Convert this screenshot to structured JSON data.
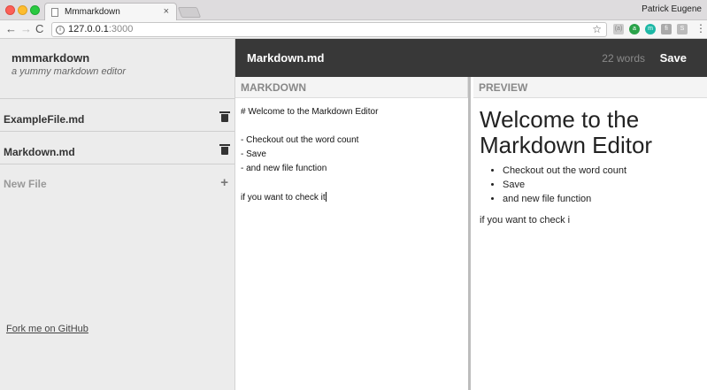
{
  "browser": {
    "tab_title": "Mmmarkdown",
    "tab_close": "×",
    "profile_name": "Patrick Eugene",
    "url_host": "127.0.0.1",
    "url_port": ":3000",
    "nav_back": "←",
    "nav_forward": "→",
    "nav_reload": "C",
    "star": "☆",
    "menu": "⋮",
    "info": "i",
    "extensions": [
      "(a)",
      "a",
      "m",
      "fi",
      "S"
    ]
  },
  "sidebar": {
    "app_name": "mmmarkdown",
    "tagline": "a yummy markdown editor",
    "files": [
      {
        "name": "ExampleFile.md",
        "icon": "trash-icon"
      },
      {
        "name": "Markdown.md",
        "icon": "trash-icon"
      }
    ],
    "new_file_label": "New File",
    "new_file_icon": "+",
    "github_link": "Fork me on GitHub"
  },
  "header": {
    "doc_title": "Markdown.md",
    "word_count": "22 words",
    "save_label": "Save"
  },
  "panes": {
    "markdown_label": "MARKDOWN",
    "preview_label": "PREVIEW"
  },
  "markdown_lines": [
    "# Welcome to the Markdown Editor",
    "",
    "- Checkout out the word count",
    "- Save",
    "- and new file function",
    "",
    "if you want to check it"
  ],
  "preview": {
    "heading": "Welcome to the Markdown Editor",
    "list": [
      "Checkout out the word count",
      "Save",
      "and new file function"
    ],
    "paragraph": "if you want to check i"
  }
}
